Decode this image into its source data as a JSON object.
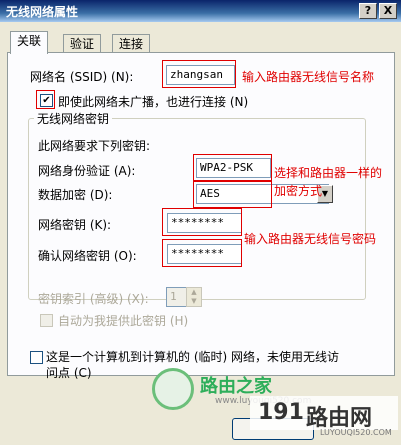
{
  "window": {
    "title": "无线网络属性",
    "help_btn": "?",
    "close_btn": "X"
  },
  "tabs": [
    {
      "label": "关联"
    },
    {
      "label": "验证"
    },
    {
      "label": "连接"
    }
  ],
  "ssid": {
    "label": "网络名 (SSID) (N):",
    "value": "zhangsan",
    "note": "输入路由器无线信号名称"
  },
  "broadcast_check": {
    "label": "即使此网络未广播，也进行连接 (N)",
    "checked": true
  },
  "key_group": {
    "title": "无线网络密钥",
    "desc": "此网络要求下列密钥:",
    "auth": {
      "label": "网络身份验证 (A):",
      "value": "WPA2-PSK"
    },
    "encrypt": {
      "label": "数据加密 (D):",
      "value": "AES"
    },
    "combo_note_1": "选择和路由器一样的",
    "combo_note_2": "加密方式",
    "net_key": {
      "label": "网络密钥 (K):",
      "value": "********"
    },
    "confirm_key": {
      "label": "确认网络密钥 (O):",
      "value": "********"
    },
    "pwd_note": "输入路由器无线信号密码",
    "key_index": {
      "label": "密钥索引 (高级) (X):",
      "value": "1"
    },
    "auto_key": {
      "label": "自动为我提供此密钥 (H)"
    }
  },
  "adhoc": {
    "label_line1": "这是一个计算机到计算机的 (临时) 网络，未使用无线访",
    "label_line2": "问点 (C)"
  },
  "watermark": {
    "brand1": "路由之家",
    "site1": "www.luyouqi520.com",
    "brand2_num": "191",
    "brand2_text": "路由网",
    "site2": "LUYOUQI520.COM"
  }
}
